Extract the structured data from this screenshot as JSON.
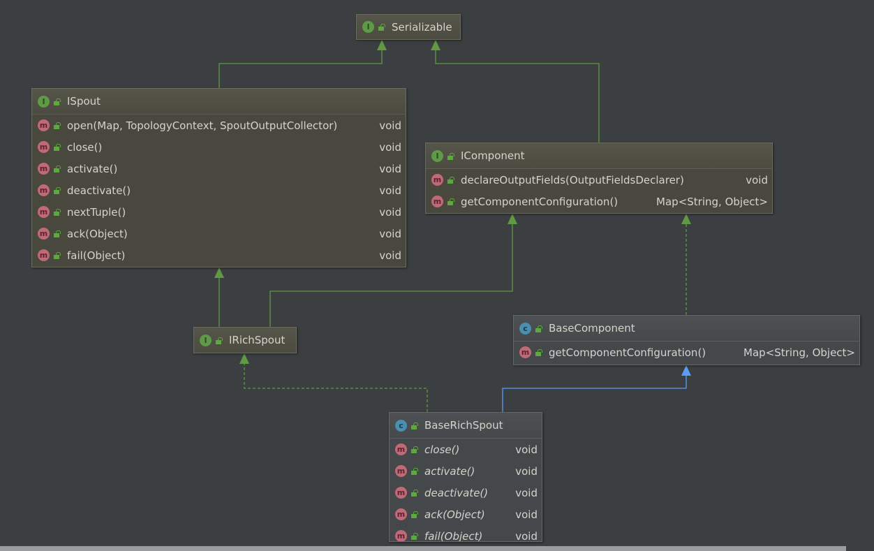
{
  "colors": {
    "background": "#3c3f41",
    "inheritance": "#5f9a43",
    "class_extends": "#589df6"
  },
  "nodes": [
    {
      "id": "serializable",
      "kind": "interface",
      "name": "Serializable",
      "members": []
    },
    {
      "id": "ispout",
      "kind": "interface",
      "name": "ISpout",
      "members": [
        {
          "name": "open(Map, TopologyContext, SpoutOutputCollector)",
          "type": "void"
        },
        {
          "name": "close()",
          "type": "void"
        },
        {
          "name": "activate()",
          "type": "void"
        },
        {
          "name": "deactivate()",
          "type": "void"
        },
        {
          "name": "nextTuple()",
          "type": "void"
        },
        {
          "name": "ack(Object)",
          "type": "void"
        },
        {
          "name": "fail(Object)",
          "type": "void"
        }
      ]
    },
    {
      "id": "icomponent",
      "kind": "interface",
      "name": "IComponent",
      "members": [
        {
          "name": "declareOutputFields(OutputFieldsDeclarer)",
          "type": "void"
        },
        {
          "name": "getComponentConfiguration()",
          "type": "Map<String, Object>"
        }
      ]
    },
    {
      "id": "irichspout",
      "kind": "interface",
      "name": "IRichSpout",
      "members": []
    },
    {
      "id": "basecomponent",
      "kind": "class",
      "name": "BaseComponent",
      "members": [
        {
          "name": "getComponentConfiguration()",
          "type": "Map<String, Object>"
        }
      ]
    },
    {
      "id": "baserichspout",
      "kind": "abstract-class",
      "name": "BaseRichSpout",
      "members": [
        {
          "name": "close()",
          "type": "void"
        },
        {
          "name": "activate()",
          "type": "void"
        },
        {
          "name": "deactivate()",
          "type": "void"
        },
        {
          "name": "ack(Object)",
          "type": "void"
        },
        {
          "name": "fail(Object)",
          "type": "void"
        }
      ]
    }
  ],
  "edges": [
    {
      "from": "ispout",
      "to": "serializable",
      "style": "extends"
    },
    {
      "from": "icomponent",
      "to": "serializable",
      "style": "extends"
    },
    {
      "from": "irichspout",
      "to": "ispout",
      "style": "extends"
    },
    {
      "from": "irichspout",
      "to": "icomponent",
      "style": "extends"
    },
    {
      "from": "basecomponent",
      "to": "icomponent",
      "style": "implements"
    },
    {
      "from": "baserichspout",
      "to": "irichspout",
      "style": "implements"
    },
    {
      "from": "baserichspout",
      "to": "basecomponent",
      "style": "class-extends"
    }
  ]
}
